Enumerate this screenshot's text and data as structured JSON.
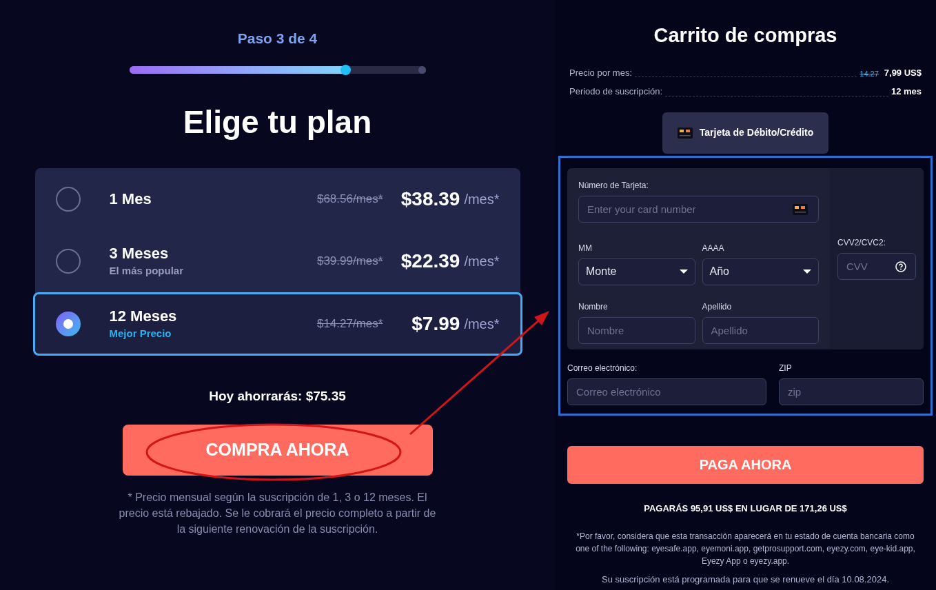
{
  "step": {
    "label": "Paso 3 de 4",
    "level": 0.73
  },
  "title": "Elige tu plan",
  "plans": [
    {
      "name": "1 Mes",
      "old_price": "$68.56/mes*",
      "price": "$38.39",
      "unit": "/mes*",
      "selected": false
    },
    {
      "name": "3 Meses",
      "subtitle": "El más popular",
      "old_price": "$39.99/mes*",
      "price": "$22.39",
      "unit": "/mes*",
      "selected": false
    },
    {
      "name": "12 Meses",
      "subtitle": "Mejor Precio",
      "old_price": "$14.27/mes*",
      "price": "$7.99",
      "unit": "/mes*",
      "selected": true
    }
  ],
  "savings": "Hoy ahorrarás: $75.35",
  "buy_button": "COMPRA AHORA",
  "footnote": "* Precio mensual según la suscripción de 1, 3 o 12 meses. El precio está rebajado. Se le cobrará el precio completo a partir de la siguiente renovación de la suscripción.",
  "cart": {
    "title": "Carrito de compras",
    "rows": [
      {
        "label": "Precio por mes:",
        "old_value": "14.27",
        "value": "7,99 US$"
      },
      {
        "label": "Periodo de suscripción:",
        "value": "12 mes"
      }
    ],
    "payment_tab": "Tarjeta de Débito/Crédito",
    "card_number": {
      "label": "Número de Tarjeta:",
      "placeholder": "Enter your card number"
    },
    "month": {
      "label": "MM",
      "value": "Monte"
    },
    "year": {
      "label": "AAAA",
      "value": "Año"
    },
    "cvv": {
      "label": "CVV2/CVC2:",
      "placeholder": "CVV"
    },
    "first_name": {
      "label": "Nombre",
      "placeholder": "Nombre"
    },
    "last_name": {
      "label": "Apellido",
      "placeholder": "Apellido"
    },
    "email": {
      "label": "Correo electrónico:",
      "placeholder": "Correo electrónico"
    },
    "zip": {
      "label": "ZIP",
      "placeholder": "zip"
    },
    "pay_button": "PAGA AHORA",
    "total_note": "PAGARÁS 95,91 US$ EN LUGAR DE 171,26 US$",
    "disclaimer": "*Por favor, considera que esta transacción aparecerá en tu estado de cuenta bancaria como one of the following: eyesafe.app, eyemoni.app, getprosupport.com, eyezy.com, eye-kid.app, Eyezy App o eyezy.app.",
    "renewal": "Su suscripción está programada para que se renueve el día 10.08.2024."
  }
}
